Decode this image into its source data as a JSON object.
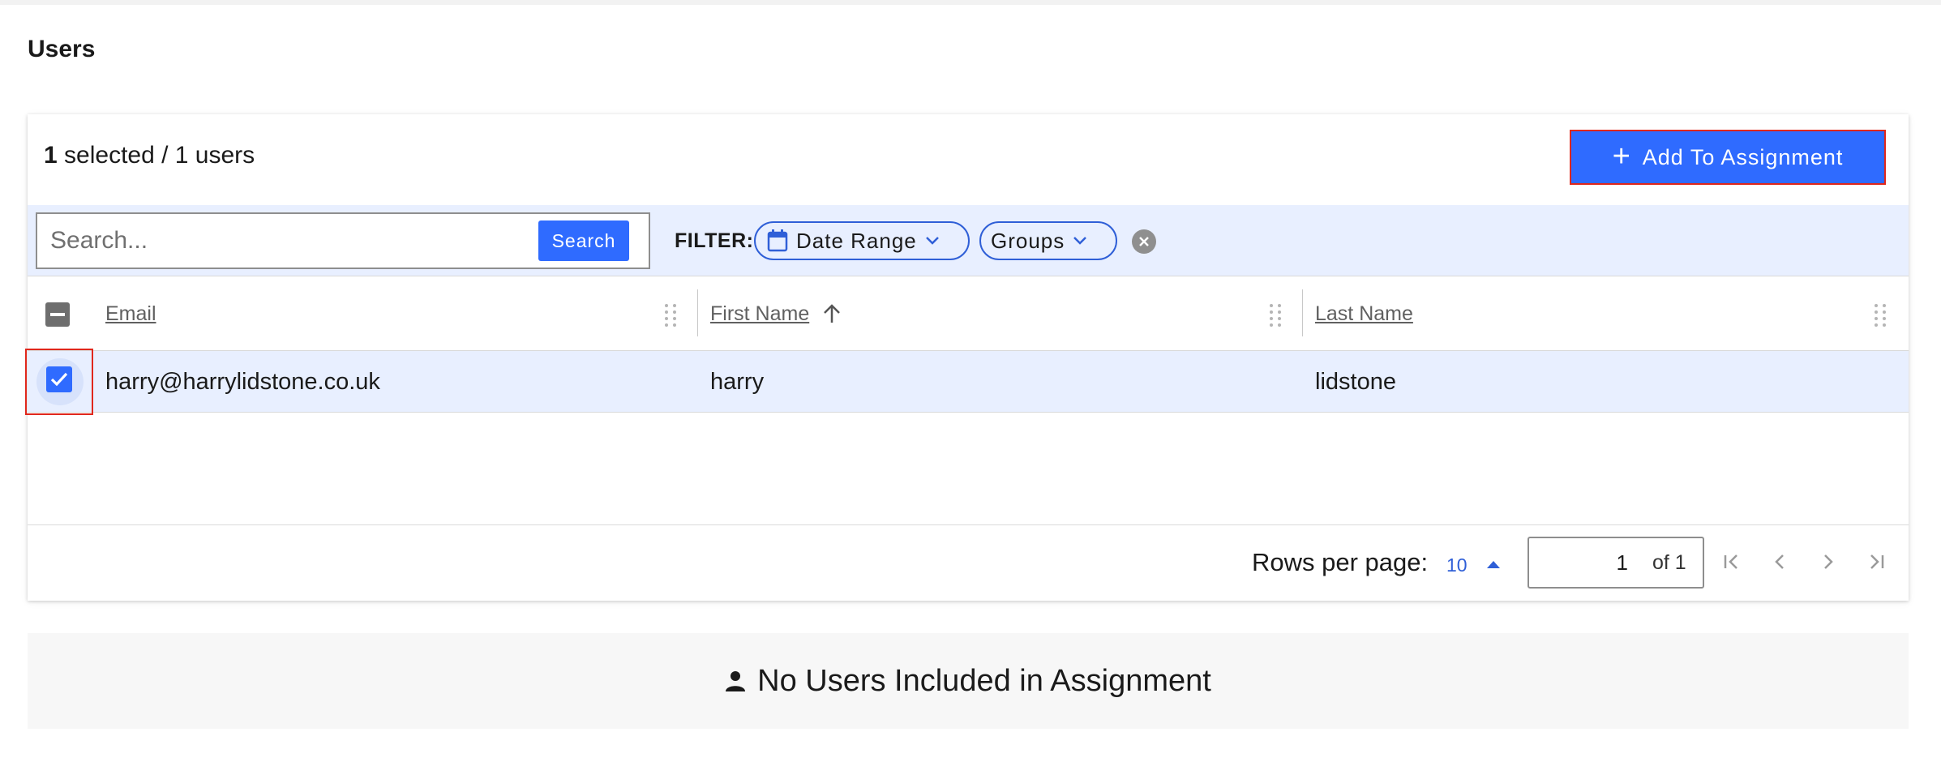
{
  "page": {
    "title": "Users"
  },
  "toolbar": {
    "selected_count": "1",
    "selected_suffix": "selected / 1 users",
    "add_button_label": "Add To Assignment"
  },
  "filter": {
    "search_placeholder": "Search...",
    "search_value": "",
    "search_button_label": "Search",
    "filter_label": "FILTER:",
    "chips": [
      {
        "label": "Date Range",
        "icon": "calendar-icon"
      },
      {
        "label": "Groups"
      }
    ]
  },
  "table": {
    "columns": [
      {
        "label": "Email"
      },
      {
        "label": "First Name ",
        "sort": "ascending"
      },
      {
        "label": "Last Name"
      }
    ],
    "rows": [
      {
        "email": "harry@harrylidstone.co.uk",
        "first_name": "harry",
        "last_name": "lidstone",
        "selected": true
      }
    ]
  },
  "pagination": {
    "rows_per_page_label": "Rows per page:",
    "rows_per_page_value": "10",
    "current_page": "1",
    "of_label": "of 1"
  },
  "assignment": {
    "empty_message": "No Users Included in Assignment",
    "icon": "person-icon"
  },
  "colors": {
    "accent": "#2f6bff",
    "row_selected_bg": "#e8efff",
    "highlight_border": "#e0271c"
  }
}
